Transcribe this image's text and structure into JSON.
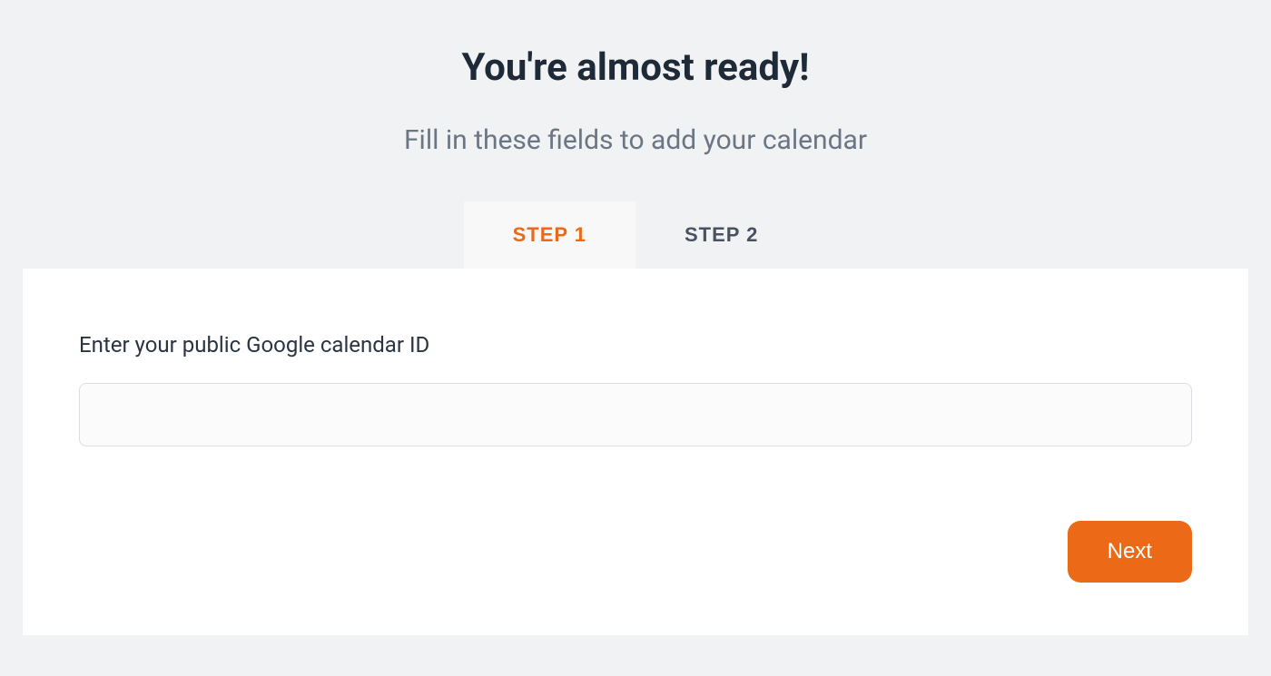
{
  "header": {
    "title": "You're almost ready!",
    "subtitle": "Fill in these fields to add your calendar"
  },
  "tabs": {
    "step1": "STEP 1",
    "step2": "STEP 2"
  },
  "form": {
    "calendar_id_label": "Enter your public Google calendar ID",
    "calendar_id_value": "",
    "next_label": "Next"
  },
  "colors": {
    "accent": "#ec6a17",
    "text_dark": "#1e2a38",
    "text_muted": "#6b7685"
  }
}
